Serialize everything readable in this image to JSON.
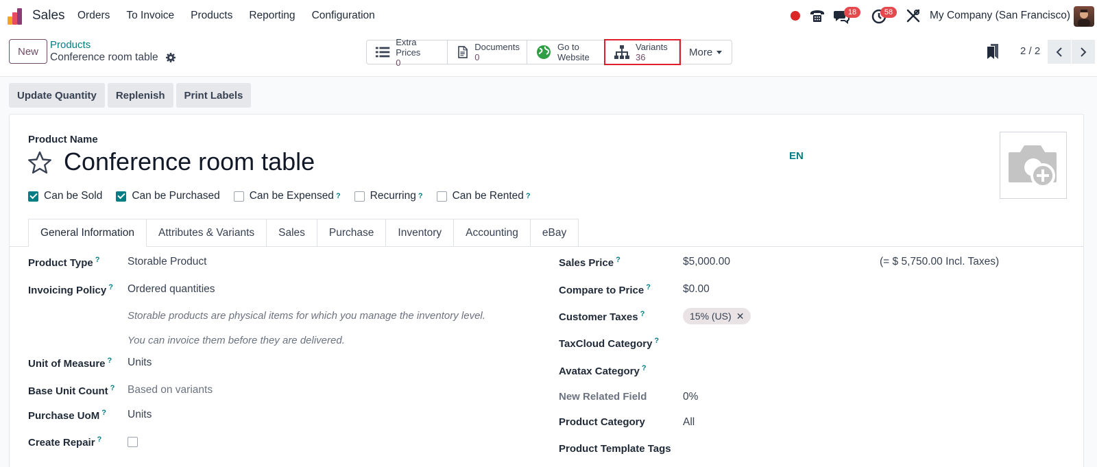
{
  "navbar": {
    "app_name": "Sales",
    "menu": [
      "Orders",
      "To Invoice",
      "Products",
      "Reporting",
      "Configuration"
    ],
    "messages_badge": "18",
    "activities_badge": "58",
    "company": "My Company (San Francisco)",
    "icons": [
      "phone-icon",
      "chat-icon",
      "clock-icon",
      "tools-icon"
    ]
  },
  "control": {
    "new_label": "New",
    "breadcrumb_parent": "Products",
    "breadcrumb_current": "Conference room table",
    "stats": [
      {
        "label": "Extra Prices",
        "value": "0",
        "icon": "list-icon"
      },
      {
        "label": "Documents",
        "value": "0",
        "icon": "document-icon"
      },
      {
        "label": "Go to",
        "value": "Website",
        "icon": "globe-icon"
      },
      {
        "label": "Variants",
        "value": "36",
        "icon": "sitemap-icon"
      }
    ],
    "more_label": "More",
    "pager": "2 / 2"
  },
  "actions": [
    "Update Quantity",
    "Replenish",
    "Print Labels"
  ],
  "form": {
    "name_label": "Product Name",
    "title": "Conference room table",
    "lang": "EN",
    "checkboxes": [
      {
        "label": "Can be Sold",
        "checked": true,
        "tip": false
      },
      {
        "label": "Can be Purchased",
        "checked": true,
        "tip": false
      },
      {
        "label": "Can be Expensed",
        "checked": false,
        "tip": true
      },
      {
        "label": "Recurring",
        "checked": false,
        "tip": true
      },
      {
        "label": "Can be Rented",
        "checked": false,
        "tip": true
      }
    ],
    "tabs": [
      "General Information",
      "Attributes & Variants",
      "Sales",
      "Purchase",
      "Inventory",
      "Accounting",
      "eBay"
    ],
    "left": {
      "product_type_label": "Product Type",
      "product_type": "Storable Product",
      "invoicing_label": "Invoicing Policy",
      "invoicing": "Ordered quantities",
      "note1": "Storable products are physical items for which you manage the inventory level.",
      "note2": "You can invoice them before they are delivered.",
      "uom_label": "Unit of Measure",
      "uom": "Units",
      "base_unit_label": "Base Unit Count",
      "base_unit": "Based on variants",
      "purchase_uom_label": "Purchase UoM",
      "purchase_uom": "Units",
      "create_repair_label": "Create Repair"
    },
    "right": {
      "sales_price_label": "Sales Price",
      "sales_price": "$5,000.00",
      "incl_taxes": "(= $ 5,750.00 Incl. Taxes)",
      "compare_label": "Compare to Price",
      "compare": "$0.00",
      "taxes_label": "Customer Taxes",
      "tax_tag": "15% (US)",
      "taxcloud_label": "TaxCloud Category",
      "avatax_label": "Avatax Category",
      "new_field_label": "New Related Field",
      "new_field": "0%",
      "category_label": "Product Category",
      "category": "All",
      "tags_label": "Product Template Tags"
    }
  },
  "colors": {
    "brand": "#714b67",
    "accent": "#017e84",
    "highlight": "#e11d2a"
  }
}
